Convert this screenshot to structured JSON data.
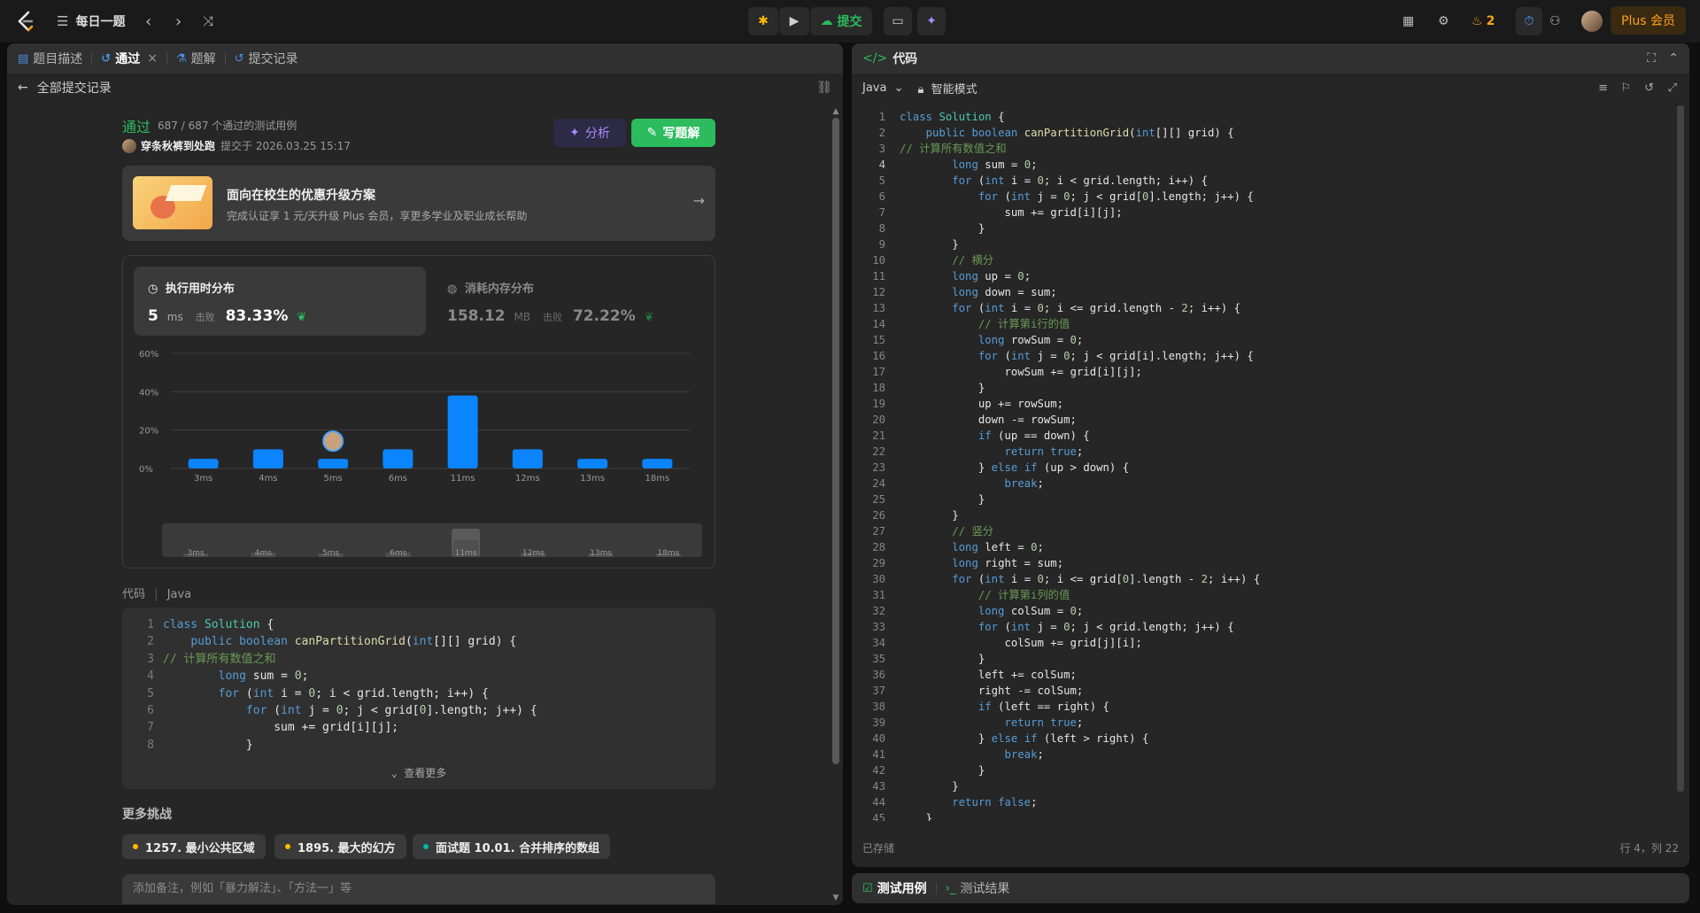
{
  "topbar": {
    "title": "每日一题",
    "submit_label": "提交",
    "streak": "2",
    "plus_label": "Plus 会员"
  },
  "left_tabs": [
    {
      "label": "题目描述",
      "icon": "document-icon"
    },
    {
      "label": "通过",
      "icon": "history-icon"
    },
    {
      "label": "题解",
      "icon": "flask-icon"
    },
    {
      "label": "提交记录",
      "icon": "history-icon"
    }
  ],
  "subhead": "全部提交记录",
  "submission": {
    "status": "通过",
    "tests": "687 / 687 个通过的测试用例",
    "user": "穿条秋裤到处跑",
    "submitted_at": "提交于 2026.03.25 15:17",
    "analyze_label": "分析",
    "solution_label": "写题解"
  },
  "promo": {
    "title": "面向在校生的优惠升级方案",
    "subtitle": "完成认证享 1 元/天升级 Plus 会员，享更多学业及职业成长帮助"
  },
  "runtime": {
    "title": "执行用时分布",
    "value": "5",
    "unit": "ms",
    "beat_label": "击败",
    "beat": "83.33%"
  },
  "memory": {
    "title": "消耗内存分布",
    "value": "158.12",
    "unit": "MB",
    "beat_label": "击败",
    "beat": "72.22%"
  },
  "chart_data": {
    "type": "bar",
    "categories": [
      "3ms",
      "4ms",
      "5ms",
      "6ms",
      "11ms",
      "12ms",
      "13ms",
      "18ms"
    ],
    "values": [
      5,
      10,
      5,
      10,
      38,
      10,
      5,
      5
    ],
    "yticks": [
      "0%",
      "20%",
      "40%",
      "60%"
    ],
    "ylim": [
      0,
      60
    ],
    "highlight": "5ms",
    "mini_highlight": "11ms",
    "bar_color": "#0a84ff",
    "grid": true
  },
  "code_section": {
    "label": "代码",
    "language": "Java",
    "see_more": "查看更多",
    "lines": [
      "class Solution {",
      "    public boolean canPartitionGrid(int[][] grid) {",
      "// 计算所有数值之和",
      "        long sum = 0;",
      "        for (int i = 0; i < grid.length; i++) {",
      "            for (int j = 0; j < grid[0].length; j++) {",
      "                sum += grid[i][j];",
      "            }"
    ]
  },
  "more": {
    "title": "更多挑战",
    "chips": [
      {
        "label": "1257. 最小公共区域",
        "color": "#ffb800"
      },
      {
        "label": "1895. 最大的幻方",
        "color": "#ffb800"
      },
      {
        "label": "面试题 10.01. 合并排序的数组",
        "color": "#00b8a3"
      }
    ]
  },
  "note_placeholder": "添加备注，例如「暴力解法」、「方法一」等",
  "editor": {
    "title": "代码",
    "language": "Java",
    "mode": "智能模式",
    "saved": "已存储",
    "cursor": "行 4，列 22",
    "lines": [
      "class Solution {",
      "    public boolean canPartitionGrid(int[][] grid) {",
      "// 计算所有数值之和",
      "        long sum = 0;",
      "        for (int i = 0; i < grid.length; i++) {",
      "            for (int j = 0; j < grid[0].length; j++) {",
      "                sum += grid[i][j];",
      "            }",
      "        }",
      "        // 横分",
      "        long up = 0;",
      "        long down = sum;",
      "        for (int i = 0; i <= grid.length - 2; i++) {",
      "            // 计算第i行的值",
      "            long rowSum = 0;",
      "            for (int j = 0; j < grid[i].length; j++) {",
      "                rowSum += grid[i][j];",
      "            }",
      "            up += rowSum;",
      "            down -= rowSum;",
      "            if (up == down) {",
      "                return true;",
      "            } else if (up > down) {",
      "                break;",
      "            }",
      "        }",
      "        // 竖分",
      "        long left = 0;",
      "        long right = sum;",
      "        for (int i = 0; i <= grid[0].length - 2; i++) {",
      "            // 计算第i列的值",
      "            long colSum = 0;",
      "            for (int j = 0; j < grid.length; j++) {",
      "                colSum += grid[j][i];",
      "            }",
      "            left += colSum;",
      "            right -= colSum;",
      "            if (left == right) {",
      "                return true;",
      "            } else if (left > right) {",
      "                break;",
      "            }",
      "        }",
      "        return false;",
      "    }"
    ]
  },
  "bottom_tabs": [
    {
      "label": "测试用例",
      "icon": "checkbox-icon"
    },
    {
      "label": "测试结果",
      "icon": "terminal-icon"
    }
  ]
}
